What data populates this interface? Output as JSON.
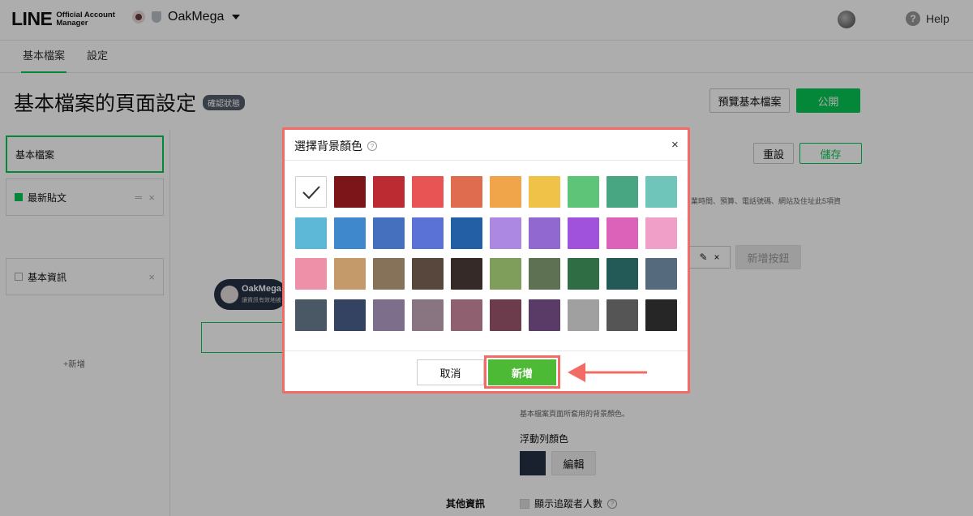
{
  "header": {
    "logo": "LINE",
    "logo_sub_line1": "Official Account",
    "logo_sub_line2": "Manager",
    "account_name": "OakMega",
    "help": "Help"
  },
  "tabs": [
    {
      "label": "基本檔案",
      "active": true
    },
    {
      "label": "設定",
      "active": false
    }
  ],
  "page": {
    "title": "基本檔案的頁面設定",
    "badge": "確認狀態",
    "preview_button": "預覽基本檔案",
    "publish_button": "公開"
  },
  "left_panel": {
    "items": [
      {
        "label": "基本檔案"
      },
      {
        "label": "最新貼文"
      },
      {
        "label": "基本資訊"
      }
    ],
    "add_label": "+新增"
  },
  "main": {
    "reset_button": "重設",
    "save_button": "儲存",
    "partial_info": "業時間、預算、電話號碼、網站及住址此5項資",
    "add_button": "新增按鈕",
    "bg_note": "基本檔案頁面所套用的背景顏色。",
    "float_bar_color": "浮動列顏色",
    "edit_button": "編輯",
    "other_info": "其他資訊",
    "show_followers": "顯示追蹤者人數",
    "preview_name": "OakMega",
    "preview_desc": "讓資訊有效地被"
  },
  "modal": {
    "title": "選擇背景顏色",
    "close": "×",
    "cancel": "取消",
    "add": "新增",
    "swatches": [
      "#ffffff",
      "#7b1519",
      "#bd2b32",
      "#e85353",
      "#e06c4f",
      "#f0a54b",
      "#f0c248",
      "#5ec578",
      "#48a683",
      "#70c5ba",
      "#5db8d8",
      "#3f88cc",
      "#4570be",
      "#5a72d6",
      "#235fa5",
      "#ac88e3",
      "#9068cf",
      "#a152dd",
      "#dc62b9",
      "#f0a0c8",
      "#ee90a8",
      "#c49a6a",
      "#857259",
      "#58473c",
      "#362a28",
      "#7f9e5b",
      "#5e7152",
      "#2f6e44",
      "#235a58",
      "#556a7c",
      "#4a5866",
      "#334361",
      "#7d6e8c",
      "#897581",
      "#8e6070",
      "#6c3c4d",
      "#5a3a66",
      "#a0a0a0",
      "#555555",
      "#262626"
    ],
    "selected_index": 0
  }
}
